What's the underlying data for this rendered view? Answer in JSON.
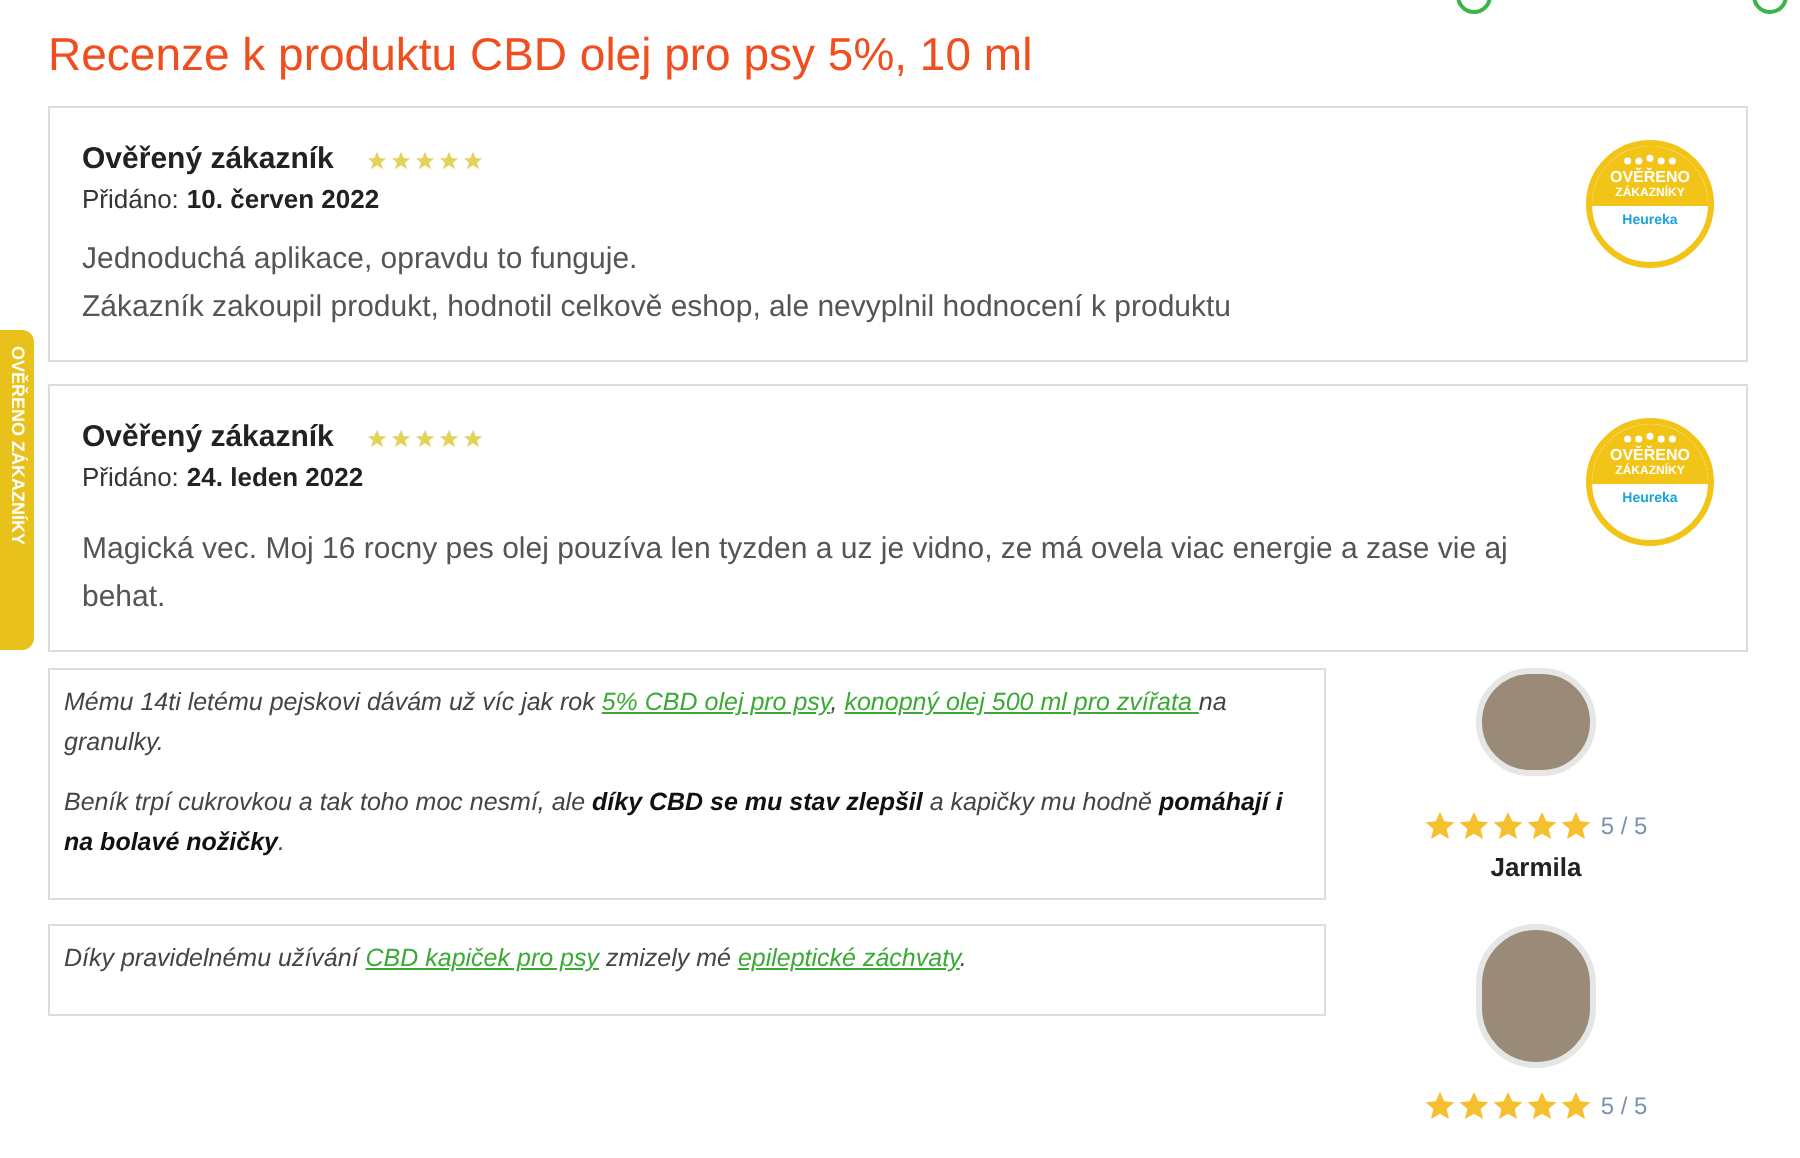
{
  "title": "Recenze k produktu CBD olej pro psy 5%, 10 ml",
  "side_tab": {
    "label": "OVĚŘENO ZÁKAZNÍKY"
  },
  "reviews": [
    {
      "author": "Ověřený zákazník",
      "stars": 5,
      "date_label": "Přidáno:",
      "date": "10. červen 2022",
      "lines": [
        "Jednoduchá aplikace, opravdu to funguje.",
        "Zákazník zakoupil produkt, hodnotil celkově eshop, ale nevyplnil hodnocení k produktu"
      ],
      "badge": {
        "line1": "OVĚŘENO",
        "line2": "ZÁKAZNÍKY",
        "brand": "Heureka"
      }
    },
    {
      "author": "Ověřený zákazník",
      "stars": 5,
      "date_label": "Přidáno:",
      "date": "24. leden 2022",
      "lines": [
        "Magická vec. Moj 16 rocny pes olej pouzíva len tyzden a uz je vidno, ze má ovela viac energie a zase vie aj behat."
      ],
      "badge": {
        "line1": "OVĚŘENO",
        "line2": "ZÁKAZNÍKY",
        "brand": "Heureka"
      }
    }
  ],
  "testimonials": [
    {
      "paragraphs": [
        [
          {
            "kind": "text",
            "text": "Mému 14ti letému pejskovi dávám už víc jak rok "
          },
          {
            "kind": "link",
            "text": "5% CBD olej pro psy"
          },
          {
            "kind": "text",
            "text": ", "
          },
          {
            "kind": "link",
            "text": "konopný olej 500 ml pro zvířata "
          },
          {
            "kind": "text",
            "text": "na granulky."
          }
        ],
        [
          {
            "kind": "text",
            "text": " Beník trpí cukrovkou a tak toho moc nesmí, ale **díky CBD se mu stav zlepšil** a kapičky mu hodně **pomáhají i na bolavé nožičky**."
          }
        ]
      ],
      "stars": 5,
      "score": "5 / 5",
      "name": "Jarmila"
    },
    {
      "paragraphs": [
        [
          {
            "kind": "text",
            "text": "Díky pravidelnému užívání "
          },
          {
            "kind": "link",
            "text": "CBD kapiček pro psy"
          },
          {
            "kind": "text",
            "text": " zmizely mé "
          },
          {
            "kind": "link",
            "text": "epileptické záchvaty"
          },
          {
            "kind": "text",
            "text": "."
          }
        ]
      ],
      "stars": 5,
      "score": "5 / 5"
    }
  ]
}
